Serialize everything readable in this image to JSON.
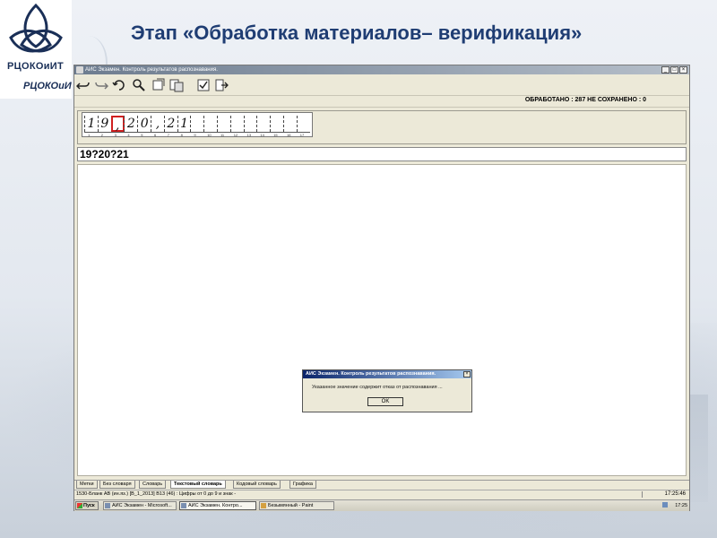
{
  "logo": {
    "text_top": "РЦОКОиИТ",
    "text_bottom": "РЦОКОиИ"
  },
  "slide": {
    "title": "Этап «Обработка материалов– верификация»"
  },
  "window": {
    "title": "АИС Экзамен. Контроль результатов распознавания.",
    "min": "_",
    "max": "□",
    "close": "×"
  },
  "toolbar": {
    "icons": [
      "undo-icon",
      "redo-icon",
      "rotate-icon",
      "search-icon",
      "pan-icon",
      "copy-icon",
      "check-icon",
      "export-icon"
    ],
    "processed_status": "ОБРАБОТАНО : 287   НЕ СОХРАНЕНО : 0"
  },
  "scan": {
    "chars": [
      "1",
      "9",
      ",",
      "2",
      "0",
      ",",
      "2",
      "1",
      "",
      "",
      "",
      "",
      "",
      "",
      "",
      "",
      ""
    ],
    "highlight_index": 2,
    "ticks": [
      "1",
      "2",
      "3",
      "4",
      "5",
      "6",
      "7",
      "8",
      "9",
      "10",
      "11",
      "12",
      "13",
      "14",
      "15",
      "16",
      "17"
    ]
  },
  "recognized_value": "19?20?21",
  "dialog": {
    "title": "АИС Экзамен. Контроль результатов распознавания.",
    "message": "Указанное значение содержит отказ от распознавания ...",
    "ok_label": "OK",
    "close": "×"
  },
  "tabs": [
    {
      "label": "Метки",
      "active": false
    },
    {
      "label": "Без словаря",
      "active": false
    },
    {
      "label": "Словарь",
      "active": false
    },
    {
      "label": "Текстовый словарь",
      "active": true
    },
    {
      "label": "Кодовый словарь",
      "active": false
    },
    {
      "label": "Графика",
      "active": false
    }
  ],
  "statusbar": {
    "text": "1530-Бланк АВ (ин.яз.) [В_1_2013]  В13 (46) : Цифры от 0 до 9 и знак -",
    "time": "17:25:46"
  },
  "taskbar": {
    "start_label": "Пуск",
    "tasks": [
      {
        "label": "АИС Экзамен - Microsoft...",
        "active": false
      },
      {
        "label": "АИС Экзамен. Контро...",
        "active": true
      },
      {
        "label": "Безымянный - Paint",
        "active": false
      }
    ],
    "clock": "17:25"
  },
  "colors": {
    "title": "#1f3d73",
    "highlight": "#d02020",
    "dialog_titlebar": "#0a246a"
  }
}
